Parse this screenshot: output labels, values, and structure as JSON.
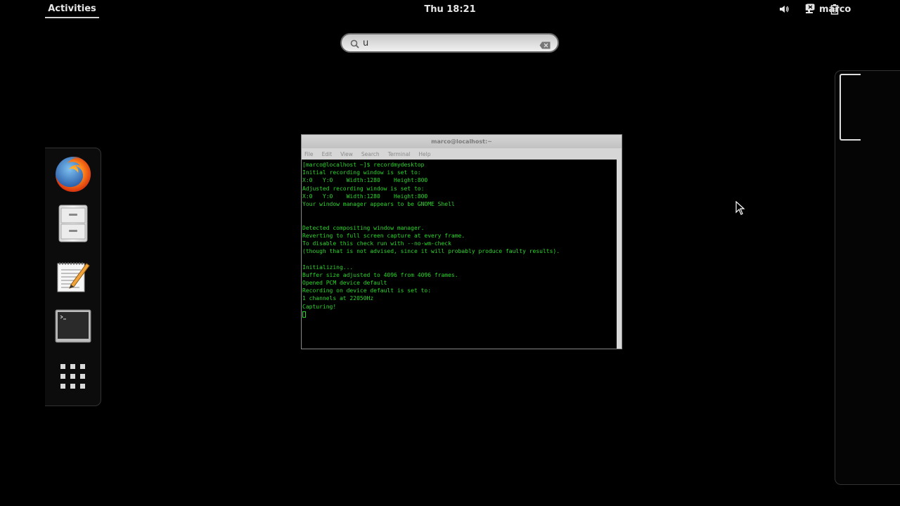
{
  "topbar": {
    "activities_label": "Activities",
    "clock": "Thu 18:21",
    "tray_icons": [
      "volume-icon",
      "network-icon",
      "battery-icon"
    ],
    "user_icon": "chat-status-icon",
    "user_name": "marco"
  },
  "search": {
    "value": "u",
    "icon": "search-icon",
    "clear_icon": "clear-icon"
  },
  "dash": {
    "items": [
      {
        "name": "Firefox",
        "icon": "firefox-icon"
      },
      {
        "name": "Files",
        "icon": "file-cabinet-icon"
      },
      {
        "name": "Text Editor",
        "icon": "text-editor-icon"
      },
      {
        "name": "Terminal",
        "icon": "terminal-icon"
      },
      {
        "name": "Show Applications",
        "icon": "app-grid-icon"
      }
    ]
  },
  "terminal": {
    "title": "marco@localhost:~",
    "menu": [
      "File",
      "Edit",
      "View",
      "Search",
      "Terminal",
      "Help"
    ],
    "lines": [
      "[marco@localhost ~]$ recordmydesktop",
      "Initial recording window is set to:",
      "X:0   Y:0    Width:1280    Height:800",
      "Adjusted recording window is set to:",
      "X:0   Y:0    Width:1280    Height:800",
      "Your window manager appears to be GNOME Shell",
      "",
      "",
      "Detected compositing window manager.",
      "Reverting to full screen capture at every frame.",
      "To disable this check run with --no-wm-check",
      "(though that is not advised, since it will probably produce faulty results).",
      "",
      "Initializing...",
      "Buffer size adjusted to 4096 from 4096 frames.",
      "Opened PCM device default",
      "Recording on device default is set to:",
      "1 channels at 22050Hz",
      "Capturing!"
    ]
  },
  "colors": {
    "terminal_text": "#2bd62b",
    "background": "#000000"
  }
}
